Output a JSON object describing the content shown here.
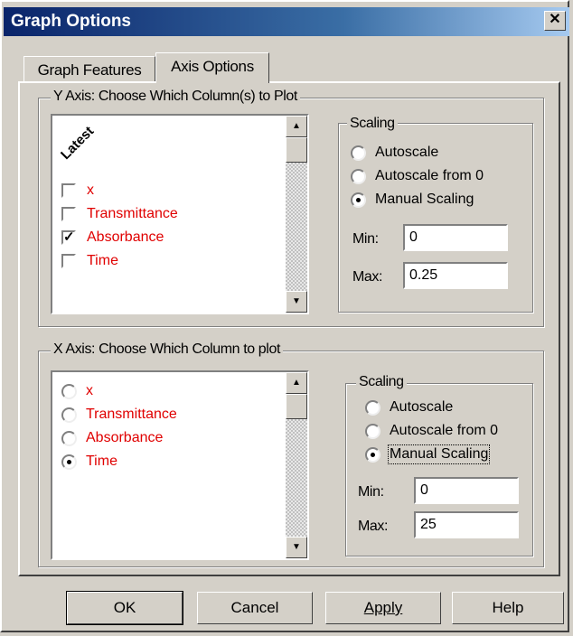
{
  "window": {
    "title": "Graph Options",
    "close_glyph": "✕"
  },
  "tabs": [
    {
      "label": "Graph Features",
      "active": false
    },
    {
      "label": "Axis Options",
      "active": true
    }
  ],
  "y_axis": {
    "group_title": "Y Axis: Choose Which Column(s) to Plot",
    "list_header": "Latest",
    "columns": [
      {
        "label": "x",
        "checked": false
      },
      {
        "label": "Transmittance",
        "checked": false
      },
      {
        "label": "Absorbance",
        "checked": true
      },
      {
        "label": "Time",
        "checked": false
      }
    ],
    "scaling": {
      "title": "Scaling",
      "options": [
        "Autoscale",
        "Autoscale from 0",
        "Manual Scaling"
      ],
      "selected": "Manual Scaling",
      "min_label": "Min:",
      "min_value": "0",
      "max_label": "Max:",
      "max_value": "0.25"
    }
  },
  "x_axis": {
    "group_title": "X Axis: Choose Which Column to plot",
    "columns": [
      {
        "label": "x",
        "selected": false
      },
      {
        "label": "Transmittance",
        "selected": false
      },
      {
        "label": "Absorbance",
        "selected": false
      },
      {
        "label": "Time",
        "selected": true
      }
    ],
    "scaling": {
      "title": "Scaling",
      "options": [
        "Autoscale",
        "Autoscale from 0",
        "Manual Scaling"
      ],
      "selected": "Manual Scaling",
      "min_label": "Min:",
      "min_value": "0",
      "max_label": "Max:",
      "max_value": "25"
    }
  },
  "buttons": {
    "ok": "OK",
    "cancel": "Cancel",
    "apply": "Apply",
    "help": "Help"
  },
  "colors": {
    "column_label": "#e00000",
    "titlebar_start": "#0a246a",
    "face": "#d4d0c8"
  },
  "icons": {
    "check": "✓",
    "scroll_up": "▲",
    "scroll_down": "▼"
  }
}
